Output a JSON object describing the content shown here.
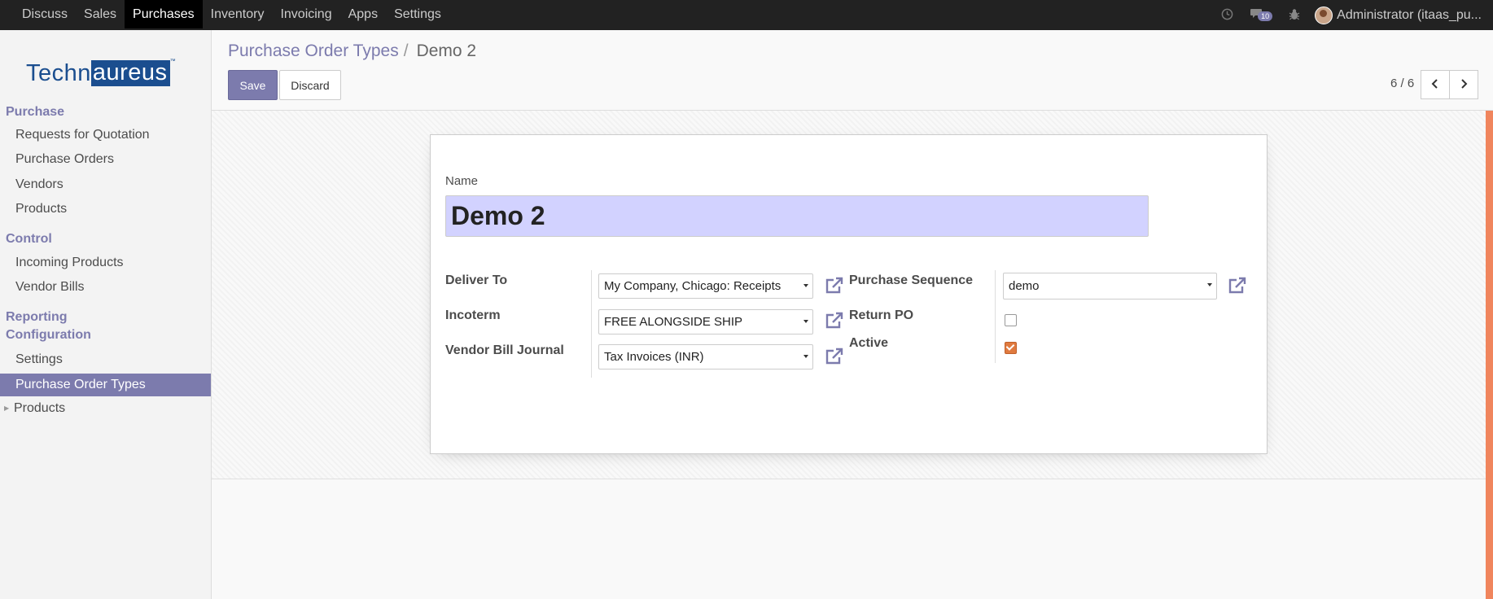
{
  "topbar": {
    "menu": [
      "Discuss",
      "Sales",
      "Purchases",
      "Inventory",
      "Invoicing",
      "Apps",
      "Settings"
    ],
    "active_menu": "Purchases",
    "message_count": "10",
    "user": "Administrator (itaas_pu..."
  },
  "logo": {
    "part1": "Techn",
    "part2": "aureus",
    "tm": "™"
  },
  "sidebar": {
    "purchase_header": "Purchase",
    "purchase_items": [
      "Requests for Quotation",
      "Purchase Orders",
      "Vendors",
      "Products"
    ],
    "control_header": "Control",
    "control_items": [
      "Incoming Products",
      "Vendor Bills"
    ],
    "reporting_header": "Reporting",
    "configuration_header": "Configuration",
    "configuration_items": [
      "Settings",
      "Purchase Order Types"
    ],
    "products_group": "Products"
  },
  "breadcrumb": {
    "parent": "Purchase Order Types",
    "separator": "/",
    "current": "Demo 2"
  },
  "buttons": {
    "save": "Save",
    "discard": "Discard"
  },
  "pager": {
    "value": "6 / 6"
  },
  "form": {
    "name_label": "Name",
    "name_value": "Demo 2",
    "deliver_to_label": "Deliver To",
    "deliver_to_value": "My Company, Chicago: Receipts",
    "incoterm_label": "Incoterm",
    "incoterm_value": "FREE ALONGSIDE SHIP",
    "journal_label": "Vendor Bill Journal",
    "journal_value": "Tax Invoices (INR)",
    "sequence_label": "Purchase Sequence",
    "sequence_value": "demo",
    "return_po_label": "Return PO",
    "return_po_checked": false,
    "active_label": "Active",
    "active_checked": true
  },
  "colors": {
    "accent": "#7c7bad",
    "topbar": "#222222",
    "name_bg": "#d2d2ff",
    "checkbox_on": "#e07a3f",
    "status_strip": "#f0855d"
  },
  "icons": [
    "clock-icon",
    "chat-icon",
    "bug-icon",
    "chevron-left-icon",
    "chevron-right-icon",
    "external-link-icon"
  ]
}
